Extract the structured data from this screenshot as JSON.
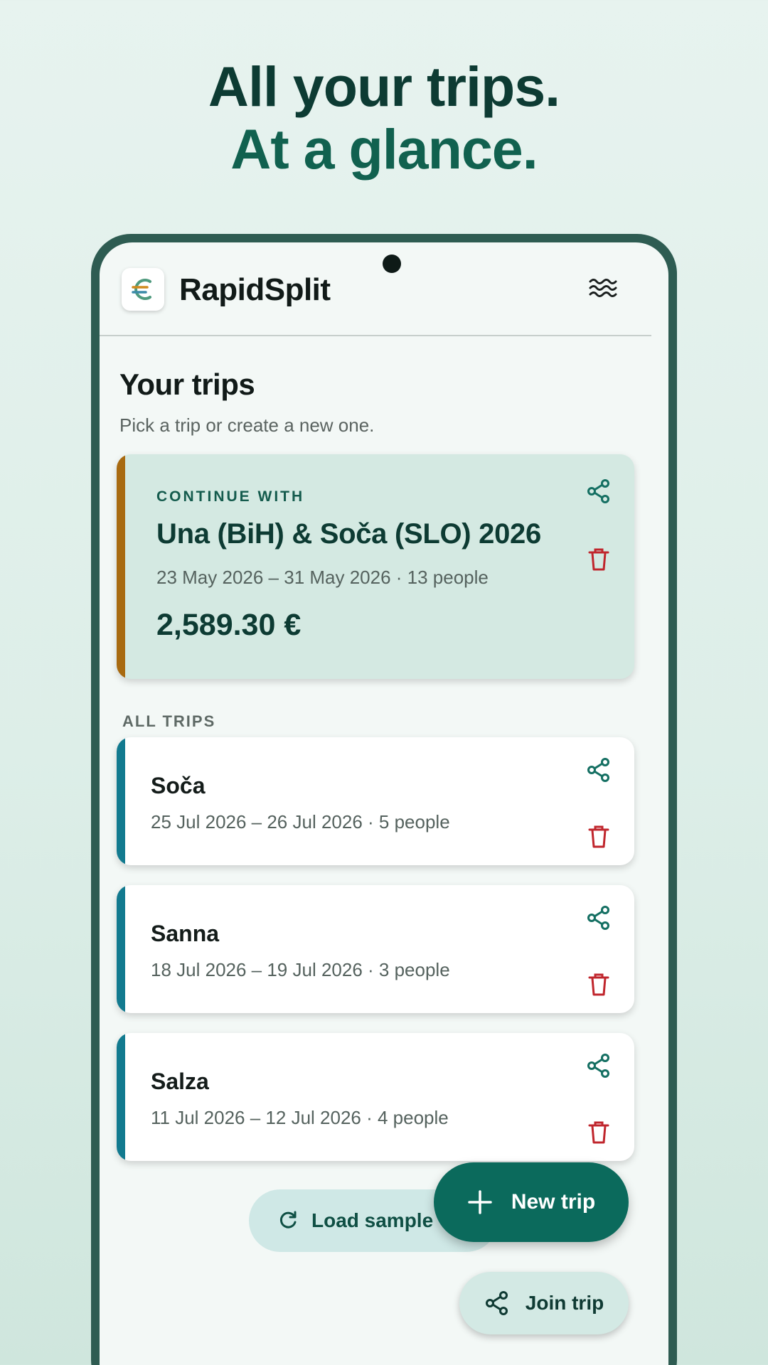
{
  "headline": {
    "line1": "All your trips.",
    "line2": "At a glance."
  },
  "appbar": {
    "title": "RapidSplit",
    "logo_glyph": "€",
    "menu_icon": "waves-icon"
  },
  "page": {
    "title": "Your trips",
    "subtitle": "Pick a trip or create a new one."
  },
  "featured": {
    "label": "CONTINUE WITH",
    "name": "Una (BiH) & Soča (SLO) 2026",
    "meta": "23 May 2026 – 31 May 2026 · 13 people",
    "amount": "2,589.30 €"
  },
  "all_trips_label": "ALL TRIPS",
  "trips": [
    {
      "name": "Soča",
      "meta": "25 Jul 2026 – 26 Jul 2026 · 5 people"
    },
    {
      "name": "Sanna",
      "meta": "18 Jul 2026 – 19 Jul 2026 · 3 people"
    },
    {
      "name": "Salza",
      "meta": "11 Jul 2026 – 12 Jul 2026 · 4 people"
    }
  ],
  "actions": {
    "load_sample": "Load sample",
    "new_trip": "New trip",
    "join_trip": "Join trip"
  },
  "colors": {
    "primary": "#0b6a5c",
    "featured_accent": "#a86a10",
    "trip_accent": "#127a8f",
    "delete": "#c0262d",
    "share": "#146f62"
  }
}
